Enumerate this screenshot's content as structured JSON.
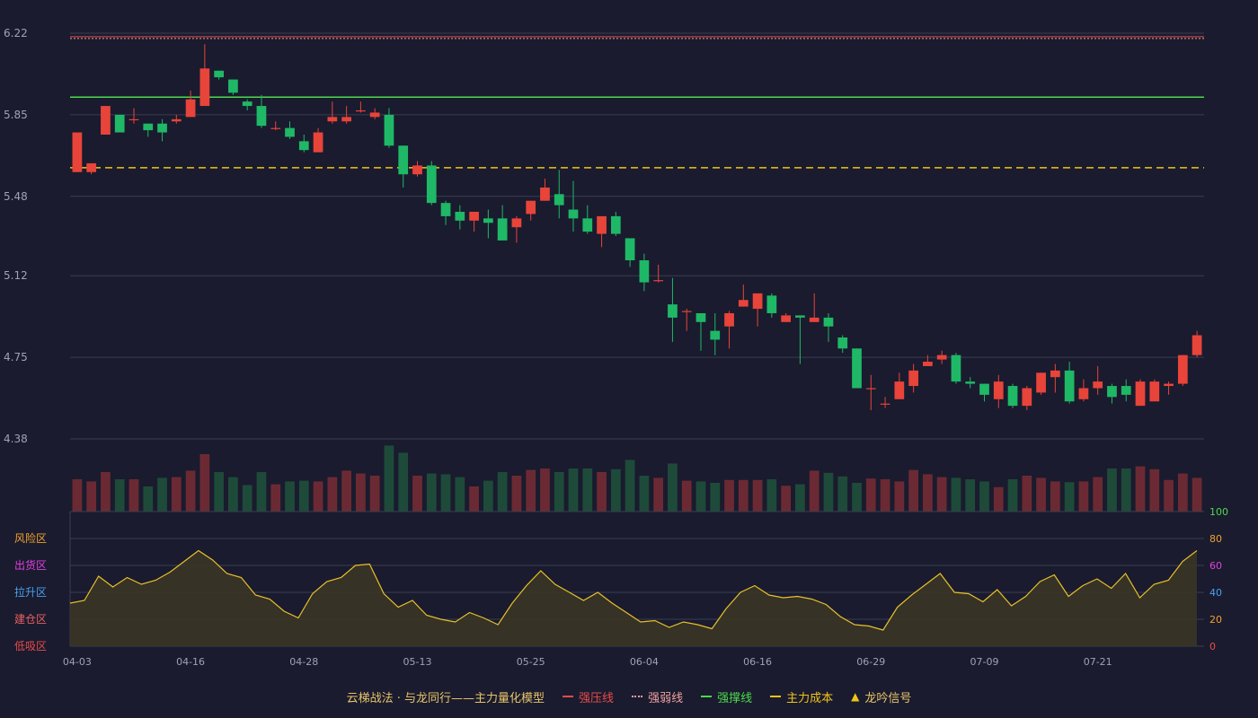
{
  "colors": {
    "background": "#1a1b2e",
    "up": "#e8443a",
    "down": "#1fb866",
    "vol_up": "#6b2a33",
    "vol_down": "#1e4a3a",
    "grid": "#3a3c52",
    "axis_text": "#a0a3b3",
    "pressure": "#e84b4b",
    "weak": "#f0a0a0",
    "support": "#4cd94c",
    "cost": "#f0c419",
    "osc_line": "#e8c02a",
    "osc_fill": "#3a3526"
  },
  "chart_data": {
    "type": "candlestick",
    "title": "",
    "price_axis": {
      "ylim": [
        4.38,
        6.22
      ],
      "ticks": [
        "6.22",
        "5.85",
        "5.48",
        "5.12",
        "4.75",
        "4.38"
      ]
    },
    "x_ticks": [
      {
        "index": 0,
        "label": "04-03"
      },
      {
        "index": 8,
        "label": "04-16"
      },
      {
        "index": 16,
        "label": "04-28"
      },
      {
        "index": 24,
        "label": "05-13"
      },
      {
        "index": 32,
        "label": "05-25"
      },
      {
        "index": 40,
        "label": "06-04"
      },
      {
        "index": 48,
        "label": "06-16"
      },
      {
        "index": 56,
        "label": "06-29"
      },
      {
        "index": 64,
        "label": "07-09"
      },
      {
        "index": 72,
        "label": "07-21"
      }
    ],
    "ohlc": [
      [
        5.59,
        5.77,
        5.59,
        5.77
      ],
      [
        5.59,
        5.63,
        5.58,
        5.63
      ],
      [
        5.76,
        5.89,
        5.76,
        5.89
      ],
      [
        5.85,
        5.77,
        5.77,
        5.85
      ],
      [
        5.83,
        5.83,
        5.81,
        5.88
      ],
      [
        5.81,
        5.78,
        5.75,
        5.81
      ],
      [
        5.81,
        5.77,
        5.73,
        5.83
      ],
      [
        5.82,
        5.83,
        5.81,
        5.85
      ],
      [
        5.84,
        5.92,
        5.84,
        5.96
      ],
      [
        5.89,
        6.06,
        5.89,
        6.17
      ],
      [
        6.05,
        6.02,
        6.01,
        6.05
      ],
      [
        6.01,
        5.95,
        5.94,
        6.01
      ],
      [
        5.91,
        5.89,
        5.87,
        5.92
      ],
      [
        5.89,
        5.8,
        5.79,
        5.94
      ],
      [
        5.79,
        5.79,
        5.78,
        5.82
      ],
      [
        5.79,
        5.75,
        5.74,
        5.82
      ],
      [
        5.73,
        5.69,
        5.68,
        5.76
      ],
      [
        5.68,
        5.77,
        5.68,
        5.79
      ],
      [
        5.82,
        5.84,
        5.81,
        5.91
      ],
      [
        5.82,
        5.84,
        5.81,
        5.89
      ],
      [
        5.87,
        5.87,
        5.86,
        5.91
      ],
      [
        5.84,
        5.86,
        5.83,
        5.88
      ],
      [
        5.85,
        5.71,
        5.7,
        5.88
      ],
      [
        5.71,
        5.58,
        5.52,
        5.71
      ],
      [
        5.58,
        5.62,
        5.57,
        5.64
      ],
      [
        5.62,
        5.45,
        5.44,
        5.64
      ],
      [
        5.45,
        5.39,
        5.35,
        5.46
      ],
      [
        5.41,
        5.37,
        5.33,
        5.44
      ],
      [
        5.37,
        5.41,
        5.32,
        5.41
      ],
      [
        5.38,
        5.36,
        5.29,
        5.42
      ],
      [
        5.38,
        5.28,
        5.28,
        5.44
      ],
      [
        5.34,
        5.38,
        5.27,
        5.39
      ],
      [
        5.4,
        5.46,
        5.37,
        5.46
      ],
      [
        5.46,
        5.52,
        5.46,
        5.56
      ],
      [
        5.49,
        5.44,
        5.38,
        5.6
      ],
      [
        5.42,
        5.38,
        5.32,
        5.55
      ],
      [
        5.38,
        5.32,
        5.31,
        5.44
      ],
      [
        5.31,
        5.39,
        5.25,
        5.39
      ],
      [
        5.39,
        5.31,
        5.3,
        5.41
      ],
      [
        5.29,
        5.19,
        5.16,
        5.29
      ],
      [
        5.19,
        5.09,
        5.05,
        5.22
      ],
      [
        5.1,
        5.1,
        5.09,
        5.17
      ],
      [
        4.99,
        4.93,
        4.82,
        5.11
      ],
      [
        4.96,
        4.96,
        4.87,
        4.97
      ],
      [
        4.95,
        4.91,
        4.78,
        4.95
      ],
      [
        4.87,
        4.83,
        4.76,
        4.95
      ],
      [
        4.89,
        4.95,
        4.79,
        4.96
      ],
      [
        4.98,
        5.01,
        4.98,
        5.08
      ],
      [
        4.97,
        5.04,
        4.89,
        5.04
      ],
      [
        5.03,
        4.95,
        4.93,
        5.04
      ],
      [
        4.91,
        4.94,
        4.91,
        4.95
      ],
      [
        4.94,
        4.93,
        4.72,
        4.94
      ],
      [
        4.91,
        4.93,
        4.91,
        5.04
      ],
      [
        4.93,
        4.89,
        4.82,
        4.95
      ],
      [
        4.84,
        4.79,
        4.77,
        4.85
      ],
      [
        4.79,
        4.61,
        4.61,
        4.79
      ],
      [
        4.61,
        4.61,
        4.51,
        4.67
      ],
      [
        4.54,
        4.54,
        4.52,
        4.57
      ],
      [
        4.56,
        4.64,
        4.56,
        4.68
      ],
      [
        4.62,
        4.69,
        4.59,
        4.72
      ],
      [
        4.71,
        4.73,
        4.71,
        4.76
      ],
      [
        4.74,
        4.76,
        4.72,
        4.78
      ],
      [
        4.76,
        4.64,
        4.63,
        4.77
      ],
      [
        4.64,
        4.63,
        4.61,
        4.66
      ],
      [
        4.63,
        4.58,
        4.55,
        4.63
      ],
      [
        4.56,
        4.64,
        4.52,
        4.67
      ],
      [
        4.62,
        4.53,
        4.52,
        4.63
      ],
      [
        4.53,
        4.61,
        4.51,
        4.62
      ],
      [
        4.59,
        4.68,
        4.58,
        4.68
      ],
      [
        4.66,
        4.69,
        4.59,
        4.72
      ],
      [
        4.69,
        4.55,
        4.54,
        4.73
      ],
      [
        4.56,
        4.61,
        4.55,
        4.65
      ],
      [
        4.61,
        4.64,
        4.58,
        4.71
      ],
      [
        4.62,
        4.57,
        4.54,
        4.63
      ],
      [
        4.62,
        4.58,
        4.55,
        4.65
      ],
      [
        4.53,
        4.64,
        4.53,
        4.65
      ],
      [
        4.55,
        4.64,
        4.55,
        4.65
      ],
      [
        4.62,
        4.63,
        4.58,
        4.64
      ],
      [
        4.63,
        4.76,
        4.62,
        4.76
      ],
      [
        4.76,
        4.85,
        4.75,
        4.87
      ]
    ],
    "volume": [
      45,
      42,
      55,
      45,
      45,
      35,
      47,
      48,
      57,
      80,
      55,
      48,
      37,
      55,
      38,
      42,
      43,
      42,
      48,
      57,
      53,
      50,
      92,
      82,
      50,
      53,
      52,
      48,
      35,
      43,
      55,
      50,
      58,
      60,
      55,
      60,
      60,
      55,
      59,
      72,
      50,
      47,
      67,
      43,
      42,
      40,
      44,
      44,
      44,
      45,
      36,
      38,
      57,
      54,
      49,
      40,
      46,
      45,
      42,
      58,
      52,
      48,
      47,
      45,
      42,
      34,
      45,
      50,
      47,
      42,
      41,
      42,
      48,
      60,
      60,
      63,
      59,
      44,
      53,
      47,
      36,
      59,
      54
    ],
    "volume_max": 100,
    "osc_axis": {
      "ylim": [
        0,
        100
      ],
      "ticks": [
        "100",
        "80",
        "60",
        "40",
        "20",
        "0"
      ]
    },
    "osc_zones": [
      "风险区",
      "出货区",
      "拉升区",
      "建仓区",
      "低吸区"
    ],
    "oscillator": [
      32,
      34,
      52,
      44,
      51,
      46,
      49,
      55,
      63,
      71,
      64,
      54,
      51,
      38,
      35,
      26,
      21,
      39,
      48,
      51,
      60,
      61,
      39,
      29,
      34,
      23,
      20,
      18,
      25,
      21,
      16,
      32,
      45,
      56,
      46,
      40,
      34,
      40,
      32,
      25,
      18,
      19,
      14,
      18,
      16,
      13,
      28,
      40,
      45,
      38,
      36,
      37,
      35,
      31,
      22,
      16,
      15,
      12,
      29,
      38,
      46,
      54,
      40,
      39,
      33,
      42,
      30,
      37,
      48,
      53,
      37,
      45,
      50,
      43,
      54,
      36,
      46,
      49,
      63,
      71
    ],
    "levels": {
      "pressure": 6.2,
      "support": 5.93,
      "cost": 5.61
    },
    "legend": [
      {
        "key": "title",
        "label": "云梯战法 · 与龙同行——主力量化模型"
      },
      {
        "key": "pressure",
        "label": "强压线"
      },
      {
        "key": "weak",
        "label": "强弱线"
      },
      {
        "key": "support",
        "label": "强撑线"
      },
      {
        "key": "cost",
        "label": "主力成本"
      },
      {
        "key": "signal",
        "label": "龙吟信号"
      }
    ]
  }
}
